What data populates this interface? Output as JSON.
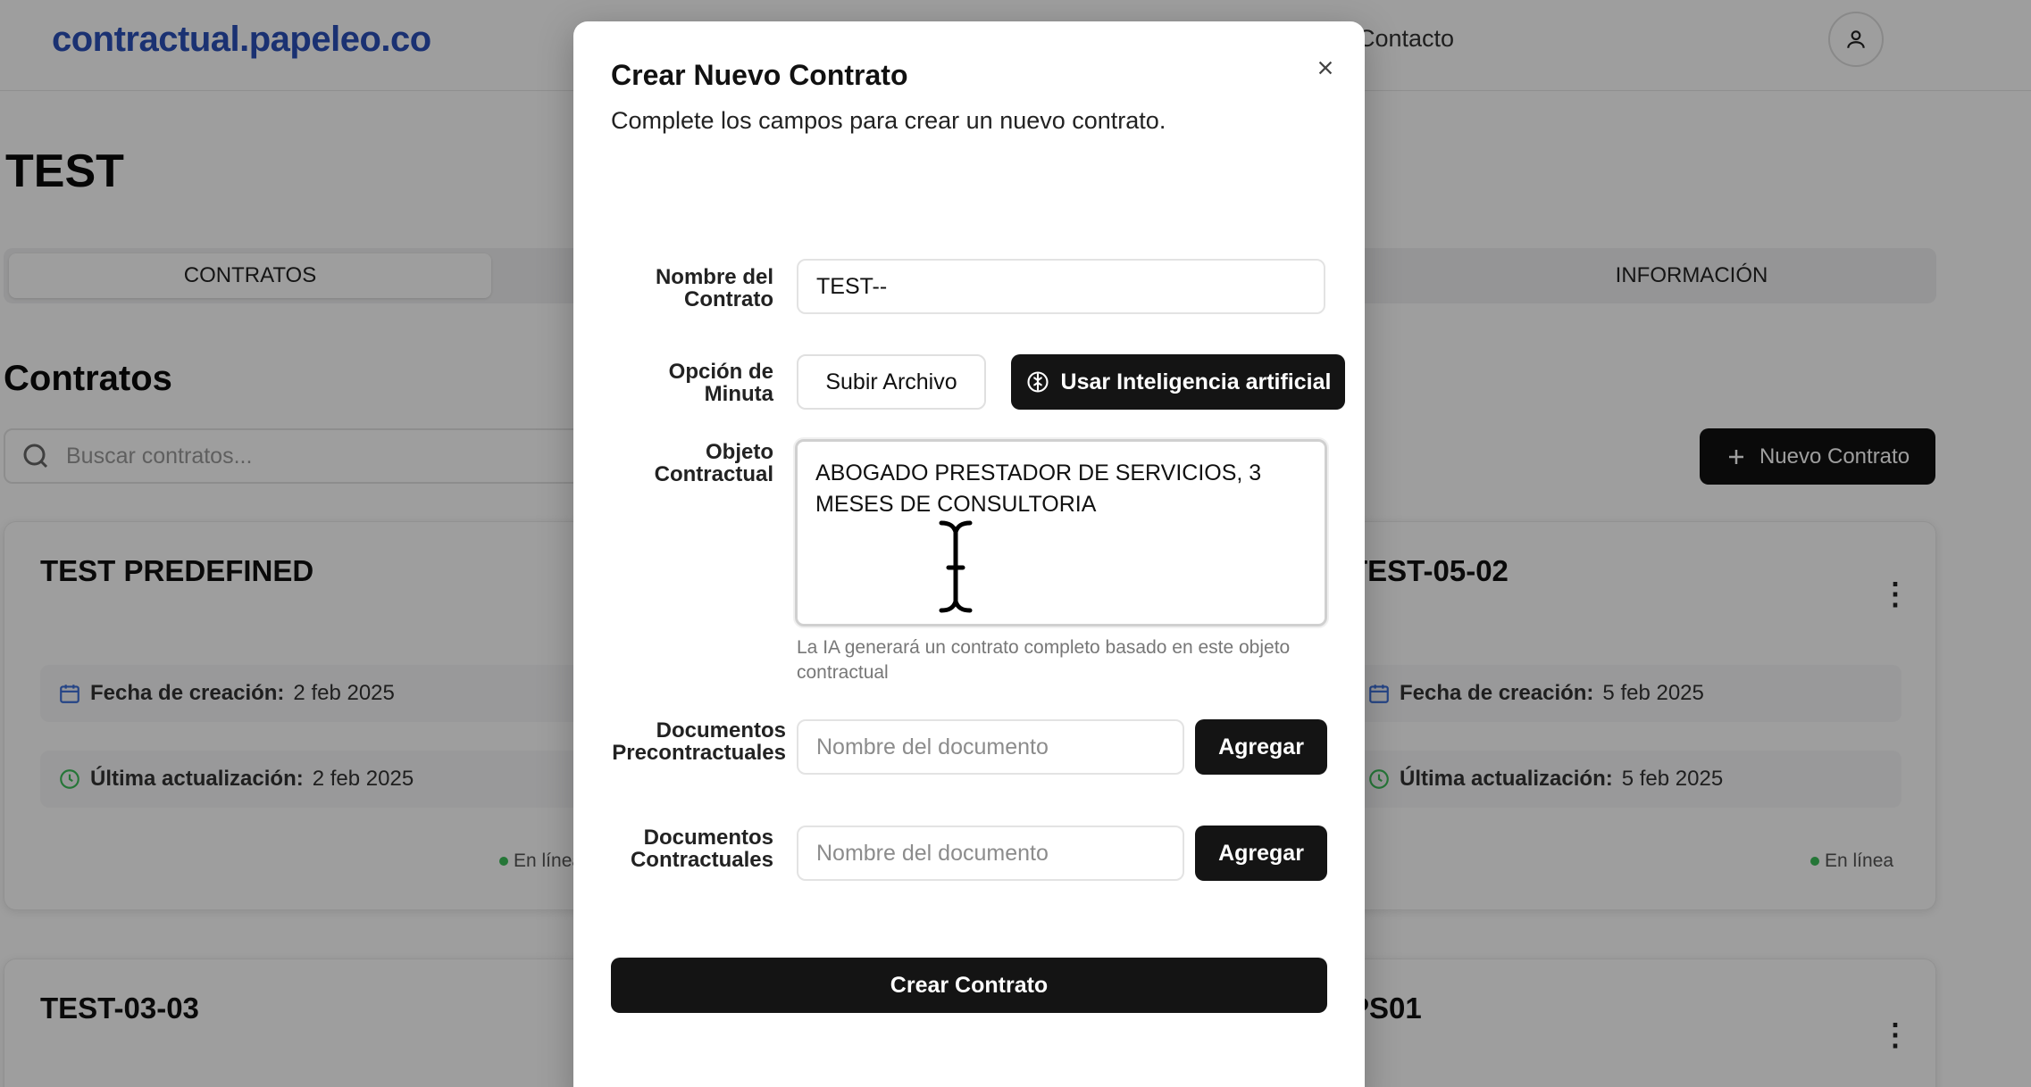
{
  "header": {
    "brand": "contractual.papeleo.co",
    "nav_contact": "Contacto"
  },
  "page": {
    "title": "TEST",
    "tabs": [
      {
        "label": "CONTRATOS"
      },
      {
        "label": "INFORMACIÓN"
      }
    ],
    "section_title": "Contratos",
    "search": {
      "placeholder": "Buscar contratos..."
    },
    "new_contract_label": "Nuevo Contrato"
  },
  "cards": [
    {
      "title": "TEST PREDEFINED",
      "created_label": "Fecha de creación:",
      "created": "2 feb 2025",
      "updated_label": "Última actualización:",
      "updated": "2 feb 2025",
      "status": "En línea"
    },
    {
      "title": "TEST-05-02",
      "created_label": "Fecha de creación:",
      "created": "5 feb 2025",
      "updated_label": "Última actualización:",
      "updated": "5 feb 2025",
      "status": "En línea"
    },
    {
      "title": "TEST-03-03"
    },
    {
      "title": "PS01"
    }
  ],
  "modal": {
    "title": "Crear Nuevo Contrato",
    "description": "Complete los campos para crear un nuevo contrato.",
    "fields": {
      "name_label": "Nombre del Contrato",
      "name_value": "TEST--",
      "option_label": "Opción de Minuta",
      "upload_button": "Subir Archivo",
      "ai_button": "Usar Inteligencia artificial",
      "object_label": "Objeto Contractual",
      "object_value": "ABOGADO PRESTADOR DE SERVICIOS, 3 MESES DE CONSULTORIA",
      "object_hint": "La IA generará un contrato completo basado en este objeto contractual",
      "precontract_label": "Documentos Precontractuales",
      "precontract_placeholder": "Nombre del documento",
      "contract_docs_label": "Documentos Contractuales",
      "contract_docs_placeholder": "Nombre del documento",
      "add_button": "Agregar"
    },
    "submit_button": "Crear Contrato"
  },
  "icons": {
    "user": "user-icon",
    "search": "search-icon",
    "plus": "plus-icon",
    "calendar": "calendar-icon",
    "clock": "clock-icon",
    "close": "close-icon",
    "brain": "brain-icon",
    "kebab": "more-vertical-icon"
  },
  "colors": {
    "brand": "#2b4fb8",
    "dark_button": "#141414",
    "status_green": "#3cbf5a",
    "calendar_blue": "#3b6fd8"
  }
}
